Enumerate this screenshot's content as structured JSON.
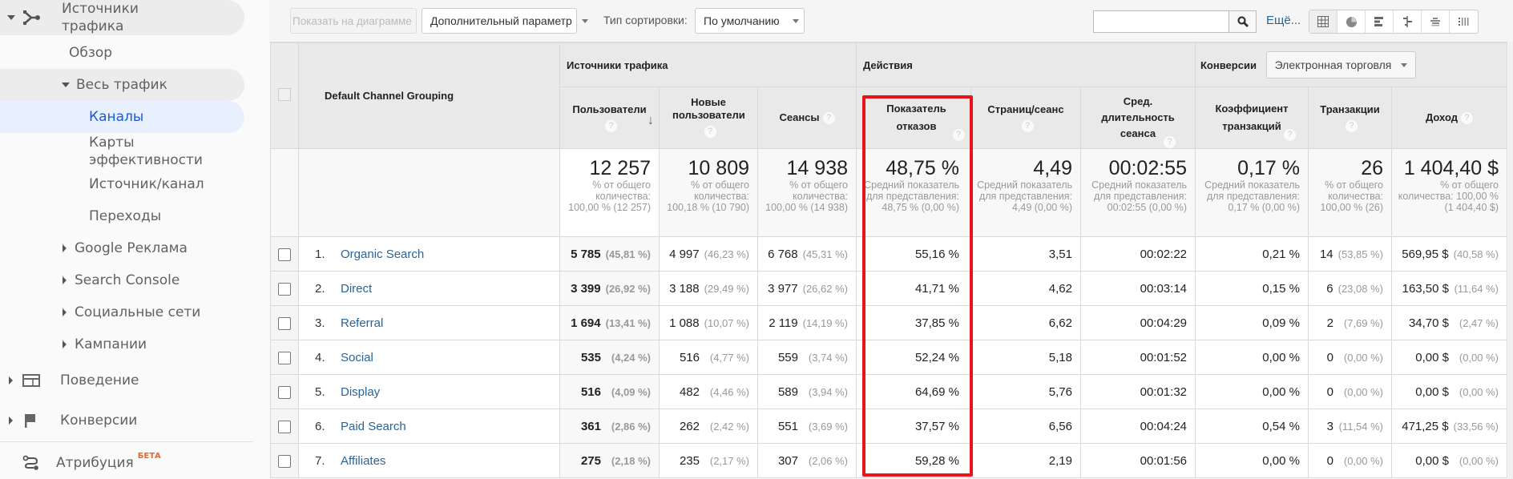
{
  "sidebar": {
    "items": [
      {
        "label": "Источники трафика",
        "icon": "acquisition-icon",
        "expanded": true
      },
      {
        "label": "Обзор"
      },
      {
        "label": "Весь трафик",
        "expanded": true
      },
      {
        "label": "Каналы",
        "active": true
      },
      {
        "label": "Карты эффективности"
      },
      {
        "label": "Источник/канал"
      },
      {
        "label": "Переходы"
      },
      {
        "label": "Google Реклама"
      },
      {
        "label": "Search Console"
      },
      {
        "label": "Социальные сети"
      },
      {
        "label": "Кампании"
      },
      {
        "label": "Поведение",
        "icon": "behavior-icon"
      },
      {
        "label": "Конверсии",
        "icon": "flag-icon"
      },
      {
        "label": "Атрибуция",
        "icon": "attribution-icon",
        "badge": "БЕТА"
      }
    ]
  },
  "toolbar": {
    "plot_rows_label": "Показать на диаграмме",
    "secondary_dimension_label": "Дополнительный параметр",
    "sort_type_label": "Тип сортировки:",
    "sort_type_value": "По умолчанию",
    "search_value": "",
    "more_label": "Ещё...",
    "views": [
      "table-view-icon",
      "pie-view-icon",
      "performance-view-icon",
      "comparison-view-icon",
      "term-cloud-view-icon",
      "pivot-view-icon"
    ]
  },
  "table": {
    "dimension_header": "Default Channel Grouping",
    "groups": {
      "acquisition": "Источники трафика",
      "behavior": "Действия",
      "conversions": "Конверсии",
      "conversions_select": "Электронная торговля"
    },
    "columns": {
      "users": "Пользователи",
      "new_users": "Новые пользователи",
      "sessions": "Сеансы",
      "bounce_rate": "Показатель отказов",
      "pages_per_session": "Страниц/сеанс",
      "avg_duration": "Сред. длительность сеанса",
      "conv_rate": "Коэффициент транзакций",
      "transactions": "Транзакции",
      "revenue": "Доход"
    },
    "totals": {
      "users": {
        "value": "12 257",
        "note": "% от общего количества: 100,00 % (12 257)"
      },
      "new_users": {
        "value": "10 809",
        "note": "% от общего количества: 100,18 % (10 790)"
      },
      "sessions": {
        "value": "14 938",
        "note": "% от общего количества: 100,00 % (14 938)"
      },
      "bounce_rate": {
        "value": "48,75 %",
        "note": "Средний показатель для представления: 48,75 % (0,00 %)"
      },
      "pages_per_session": {
        "value": "4,49",
        "note": "Средний показатель для представления: 4,49 (0,00 %)"
      },
      "avg_duration": {
        "value": "00:02:55",
        "note": "Средний показатель для представления: 00:02:55 (0,00 %)"
      },
      "conv_rate": {
        "value": "0,17 %",
        "note": "Средний показатель для представления: 0,17 % (0,00 %)"
      },
      "transactions": {
        "value": "26",
        "note": "% от общего количества: 100,00 % (26)"
      },
      "revenue": {
        "value": "1 404,40 $",
        "note": "% от общего количества: 100,00 % (1 404,40 $)"
      }
    },
    "rows": [
      {
        "idx": "1.",
        "channel": "Organic Search",
        "users": "5 785",
        "users_pct": "(45,81 %)",
        "new_users": "4 997",
        "new_users_pct": "(46,23 %)",
        "sessions": "6 768",
        "sessions_pct": "(45,31 %)",
        "bounce_rate": "55,16 %",
        "pages": "3,51",
        "duration": "00:02:22",
        "conv_rate": "0,21 %",
        "transactions": "14",
        "transactions_pct": "(53,85 %)",
        "revenue": "569,95 $",
        "revenue_pct": "(40,58 %)"
      },
      {
        "idx": "2.",
        "channel": "Direct",
        "users": "3 399",
        "users_pct": "(26,92 %)",
        "new_users": "3 188",
        "new_users_pct": "(29,49 %)",
        "sessions": "3 977",
        "sessions_pct": "(26,62 %)",
        "bounce_rate": "41,71 %",
        "pages": "4,62",
        "duration": "00:03:14",
        "conv_rate": "0,15 %",
        "transactions": "6",
        "transactions_pct": "(23,08 %)",
        "revenue": "163,50 $",
        "revenue_pct": "(11,64 %)"
      },
      {
        "idx": "3.",
        "channel": "Referral",
        "users": "1 694",
        "users_pct": "(13,41 %)",
        "new_users": "1 088",
        "new_users_pct": "(10,07 %)",
        "sessions": "2 119",
        "sessions_pct": "(14,19 %)",
        "bounce_rate": "37,85 %",
        "pages": "6,62",
        "duration": "00:04:29",
        "conv_rate": "0,09 %",
        "transactions": "2",
        "transactions_pct": "(7,69 %)",
        "revenue": "34,70 $",
        "revenue_pct": "(2,47 %)"
      },
      {
        "idx": "4.",
        "channel": "Social",
        "users": "535",
        "users_pct": "(4,24 %)",
        "new_users": "516",
        "new_users_pct": "(4,77 %)",
        "sessions": "559",
        "sessions_pct": "(3,74 %)",
        "bounce_rate": "52,24 %",
        "pages": "5,18",
        "duration": "00:01:52",
        "conv_rate": "0,00 %",
        "transactions": "0",
        "transactions_pct": "(0,00 %)",
        "revenue": "0,00 $",
        "revenue_pct": "(0,00 %)"
      },
      {
        "idx": "5.",
        "channel": "Display",
        "users": "516",
        "users_pct": "(4,09 %)",
        "new_users": "482",
        "new_users_pct": "(4,46 %)",
        "sessions": "589",
        "sessions_pct": "(3,94 %)",
        "bounce_rate": "64,69 %",
        "pages": "5,76",
        "duration": "00:01:32",
        "conv_rate": "0,00 %",
        "transactions": "0",
        "transactions_pct": "(0,00 %)",
        "revenue": "0,00 $",
        "revenue_pct": "(0,00 %)"
      },
      {
        "idx": "6.",
        "channel": "Paid Search",
        "users": "361",
        "users_pct": "(2,86 %)",
        "new_users": "262",
        "new_users_pct": "(2,42 %)",
        "sessions": "551",
        "sessions_pct": "(3,69 %)",
        "bounce_rate": "37,57 %",
        "pages": "6,56",
        "duration": "00:04:24",
        "conv_rate": "0,54 %",
        "transactions": "3",
        "transactions_pct": "(11,54 %)",
        "revenue": "471,25 $",
        "revenue_pct": "(33,56 %)"
      },
      {
        "idx": "7.",
        "channel": "Affiliates",
        "users": "275",
        "users_pct": "(2,18 %)",
        "new_users": "235",
        "new_users_pct": "(2,17 %)",
        "sessions": "307",
        "sessions_pct": "(2,06 %)",
        "bounce_rate": "59,28 %",
        "pages": "2,19",
        "duration": "00:01:56",
        "conv_rate": "0,00 %",
        "transactions": "0",
        "transactions_pct": "(0,00 %)",
        "revenue": "0,00 $",
        "revenue_pct": "(0,00 %)"
      }
    ]
  },
  "highlight": {
    "column": "bounce_rate",
    "color": "#e8131b"
  }
}
